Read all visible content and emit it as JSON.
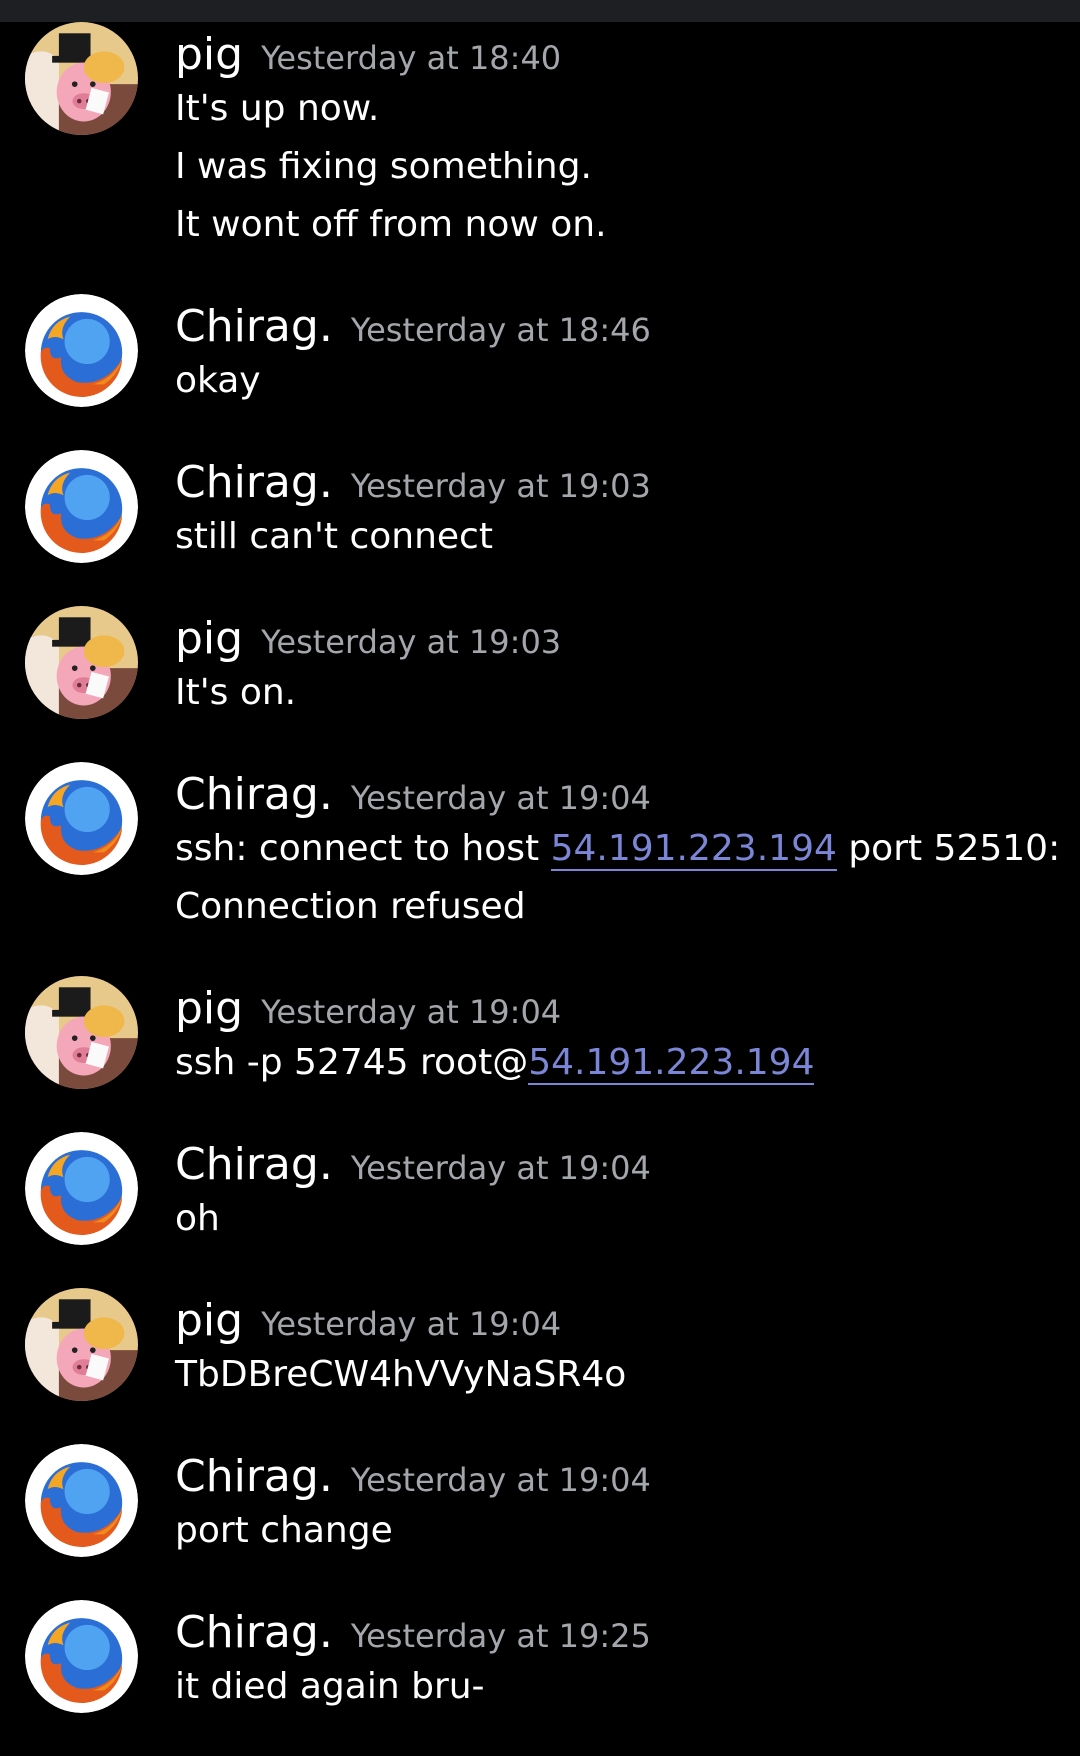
{
  "messages": [
    {
      "author": "pig",
      "avatar": "pig-avatar-icon",
      "time": "Yesterday at 18:40",
      "lines": [
        [
          {
            "t": "It's up now."
          }
        ],
        [
          {
            "t": "I was fixing something."
          }
        ],
        [
          {
            "t": "It wont off from now on."
          }
        ]
      ]
    },
    {
      "author": "Chirag.",
      "avatar": "firefox-avatar-icon",
      "time": "Yesterday at 18:46",
      "lines": [
        [
          {
            "t": "okay"
          }
        ]
      ]
    },
    {
      "author": "Chirag.",
      "avatar": "firefox-avatar-icon",
      "time": "Yesterday at 19:03",
      "lines": [
        [
          {
            "t": "still can't connect"
          }
        ]
      ]
    },
    {
      "author": "pig",
      "avatar": "pig-avatar-icon",
      "time": "Yesterday at 19:03",
      "lines": [
        [
          {
            "t": "It's on."
          }
        ]
      ]
    },
    {
      "author": "Chirag.",
      "avatar": "firefox-avatar-icon",
      "time": "Yesterday at 19:04",
      "lines": [
        [
          {
            "t": "ssh: connect to host "
          },
          {
            "t": "54.191.223.194",
            "link": true
          },
          {
            "t": " port 52510:"
          }
        ],
        [
          {
            "t": "Connection refused"
          }
        ]
      ]
    },
    {
      "author": "pig",
      "avatar": "pig-avatar-icon",
      "time": "Yesterday at 19:04",
      "lines": [
        [
          {
            "t": "ssh -p 52745 root@"
          },
          {
            "t": "54.191.223.194",
            "link": true
          }
        ]
      ]
    },
    {
      "author": "Chirag.",
      "avatar": "firefox-avatar-icon",
      "time": "Yesterday at 19:04",
      "lines": [
        [
          {
            "t": "oh"
          }
        ]
      ]
    },
    {
      "author": "pig",
      "avatar": "pig-avatar-icon",
      "time": "Yesterday at 19:04",
      "lines": [
        [
          {
            "t": "TbDBreCW4hVVyNaSR4o"
          }
        ]
      ]
    },
    {
      "author": "Chirag.",
      "avatar": "firefox-avatar-icon",
      "time": "Yesterday at 19:04",
      "lines": [
        [
          {
            "t": "port change"
          }
        ]
      ]
    },
    {
      "author": "Chirag.",
      "avatar": "firefox-avatar-icon",
      "time": "Yesterday at 19:25",
      "lines": [
        [
          {
            "t": "it died again bru-"
          }
        ]
      ]
    }
  ],
  "colors": {
    "background": "#000000",
    "timestamp": "#a3a6aa",
    "link": "#7b86d6"
  }
}
